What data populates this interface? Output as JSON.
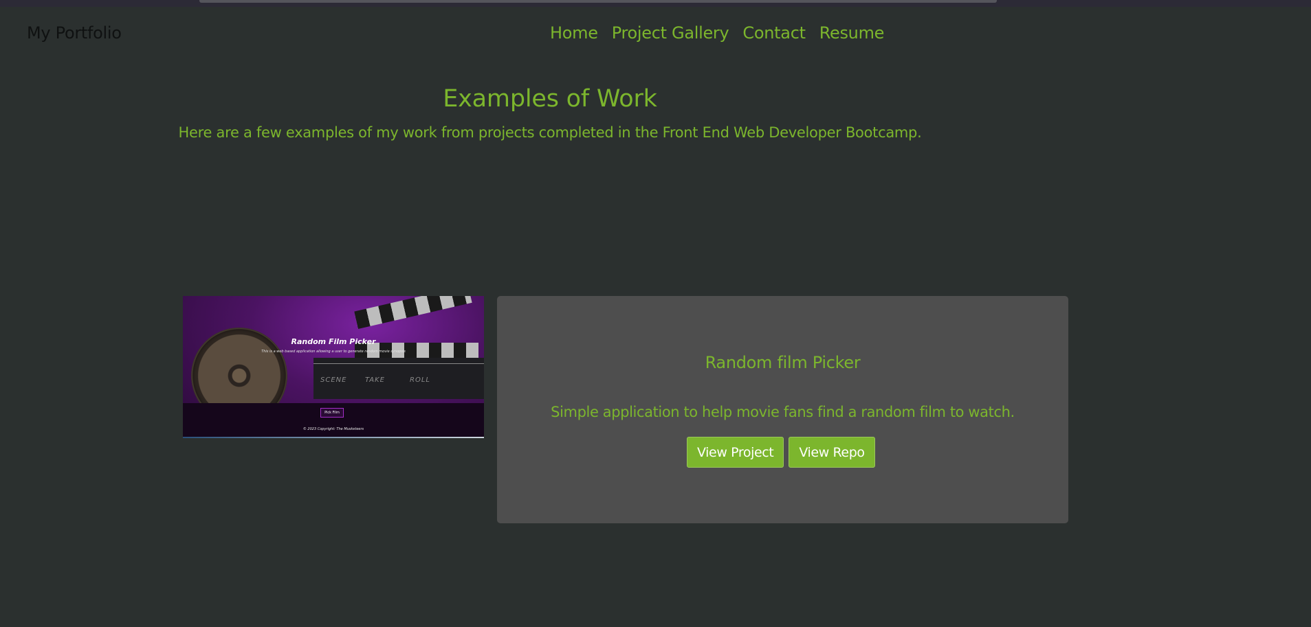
{
  "navbar": {
    "brand": "My Portfolio",
    "links": [
      "Home",
      "Project Gallery",
      "Contact",
      "Resume"
    ]
  },
  "hero": {
    "title": "Examples of Work",
    "subtitle": "Here are a few examples of my work from projects completed in the Front End Web Developer Bootcamp."
  },
  "project": {
    "thumbnail": {
      "title": "Random Film Picker",
      "subtitle": "This is a web based application allowing a user to generate random movie synopsis",
      "clapper_labels": [
        "SCENE",
        "TAKE",
        "ROLL"
      ],
      "button": "Pick Film",
      "copyright": "© 2023 Copyright: The Musketeers"
    },
    "title": "Random film Picker",
    "description": "Simple application to help movie fans find a random film to watch.",
    "buttons": {
      "view_project": "View Project",
      "view_repo": "View Repo"
    }
  },
  "colors": {
    "background": "#2b302f",
    "accent": "#7cb62d",
    "card": "#4e4e4e"
  }
}
